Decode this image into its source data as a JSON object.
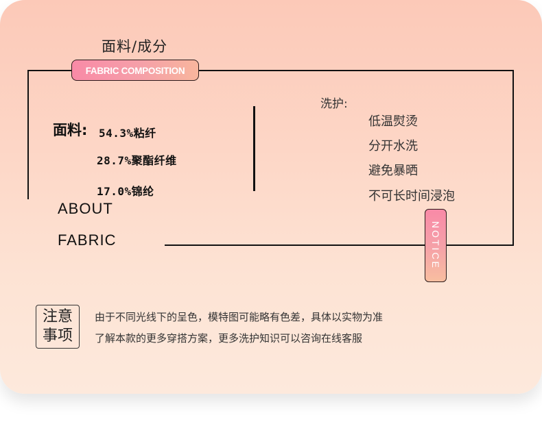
{
  "header": {
    "title_cn": "面料/成分",
    "badge": "FABRIC COMPOSITION"
  },
  "fabric": {
    "label": "面料:",
    "items": [
      "54.3%粘纤",
      "28.7%聚酯纤维",
      "17.0%锦纶"
    ]
  },
  "about": {
    "line1": "ABOUT",
    "line2": "FABRIC"
  },
  "care": {
    "label": "洗护:",
    "items": [
      "低温熨烫",
      "分开水洗",
      "避免暴晒",
      "不可长时间浸泡"
    ]
  },
  "notice": {
    "tag": "NOTICE"
  },
  "note": {
    "box_line1": "注意",
    "box_line2": "事项",
    "text_line1": "由于不同光线下的呈色，模特图可能略有色差，具体以实物为准",
    "text_line2": "了解本款的更多穿搭方案，更多洗护知识可以咨询在线客服"
  },
  "colors": {
    "background_top": "#fcc9b8",
    "background_bottom": "#fde9dc",
    "badge_pink": "#f98aa7",
    "badge_peach": "#f8b69d"
  }
}
